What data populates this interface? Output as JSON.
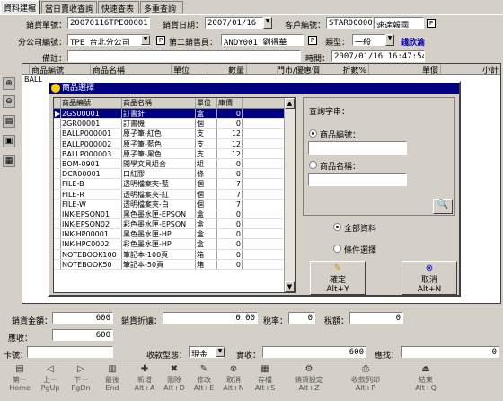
{
  "tabs": [
    "資料建檔",
    "當日賣收查詢",
    "快速查表",
    "多重查詢"
  ],
  "header": {
    "sale_no_label": "銷貨單號：",
    "sale_no": "20070116TPE00001",
    "sale_date_label": "銷貨日期：",
    "sale_date": "2007/01/16",
    "customer_label": "客戶編號：",
    "customer_code": "STAR000001",
    "customer_name": "速達報國",
    "branch_label": "分公司編號：",
    "branch": "TPE 台北分公司",
    "second_sales_label": "第二銷售員：",
    "second_sales": "ANDY001 劉得華",
    "type_label": "類型：",
    "type_value": "一般",
    "type_link": "錢欣渝",
    "memo_label": "備註：",
    "time_label": "時間：",
    "time_value": "2007/01/16 16:47:54"
  },
  "detail_columns": [
    "商品編號",
    "商品名稱",
    "單位",
    "數量",
    "門市/優惠價",
    "折數%",
    "單價",
    "小計"
  ],
  "detail_first_cell": "BALL",
  "dialog": {
    "title": "商品選擇",
    "columns": [
      "商品編號",
      "商品名稱",
      "單位",
      "庫價"
    ],
    "rows": [
      [
        "2GS00001",
        "訂書針",
        "盒",
        "0"
      ],
      [
        "2GR00001",
        "訂書機",
        "個",
        "0"
      ],
      [
        "BALLP000001",
        "原子筆-紅色",
        "支",
        "12"
      ],
      [
        "BALLP000002",
        "原子筆-藍色",
        "支",
        "12"
      ],
      [
        "BALLP000003",
        "原子筆-黑色",
        "支",
        "12"
      ],
      [
        "BOM-0901",
        "開學文具組合",
        "組",
        "0"
      ],
      [
        "DCR00001",
        "口紅膠",
        "條",
        "0"
      ],
      [
        "FILE-B",
        "透明檔案夾-藍",
        "個",
        "7"
      ],
      [
        "FILE-R",
        "透明檔案夾-紅",
        "個",
        "7"
      ],
      [
        "FILE-W",
        "透明檔案夾-白",
        "個",
        "7"
      ],
      [
        "INK-EPSON01",
        "黑色墨水匣-EPSON",
        "盒",
        "0"
      ],
      [
        "INK-EPSON02",
        "彩色墨水匣-EPSON",
        "盒",
        "0"
      ],
      [
        "INK-HP00001",
        "黑色墨水匣-HP",
        "盒",
        "0"
      ],
      [
        "INK-HPC0002",
        "彩色墨水匣-HP",
        "盒",
        "0"
      ],
      [
        "NOTEBOOK100",
        "筆記本-100頁",
        "箱",
        "0"
      ],
      [
        "NOTEBOOK50",
        "筆記本-50頁",
        "箱",
        "0"
      ]
    ],
    "query_label": "查詢字串：",
    "opt_code": "商品編號：",
    "opt_name": "商品名稱：",
    "all_data": "全部資料",
    "cond_select": "條件選擇",
    "ok": "確定",
    "ok_key": "Alt+Y",
    "cancel": "取消",
    "cancel_key": "Alt+N"
  },
  "footer": {
    "sale_amount_label": "銷貨金額：",
    "sale_amount": "600",
    "discount_label": "銷貨折讓：",
    "discount": "0.00",
    "tax_rate_label": "稅率：",
    "tax_rate": "0",
    "tax_label": "稅額：",
    "tax": "0",
    "receivable_label": "應收：",
    "receivable": "600",
    "card_label": "卡號：",
    "pay_type_label": "收款型態：",
    "pay_type": "現金",
    "received_label": "實收：",
    "received": "600",
    "change_label": "應找：",
    "change": "0"
  },
  "toolbar": [
    {
      "label": "第一",
      "key": "Home",
      "icon": "first"
    },
    {
      "label": "上一",
      "key": "PgUp",
      "icon": "prev"
    },
    {
      "label": "下一",
      "key": "PgDn",
      "icon": "next"
    },
    {
      "label": "最後",
      "key": "End",
      "icon": "last"
    },
    {
      "label": "新增",
      "key": "Alt+A",
      "icon": "new"
    },
    {
      "label": "刪除",
      "key": "Alt+D",
      "icon": "delete"
    },
    {
      "label": "修改",
      "key": "Alt+E",
      "icon": "edit"
    },
    {
      "label": "取消",
      "key": "Alt+N",
      "icon": "cancel"
    },
    {
      "label": "存檔",
      "key": "Alt+S",
      "icon": "save"
    },
    {
      "label": "銷貨設定",
      "key": "Alt+Z",
      "icon": "settings"
    },
    {
      "label": "收款列印",
      "key": "Alt+P",
      "icon": "print"
    },
    {
      "label": "結束",
      "key": "Alt+Q",
      "icon": "exit"
    }
  ]
}
